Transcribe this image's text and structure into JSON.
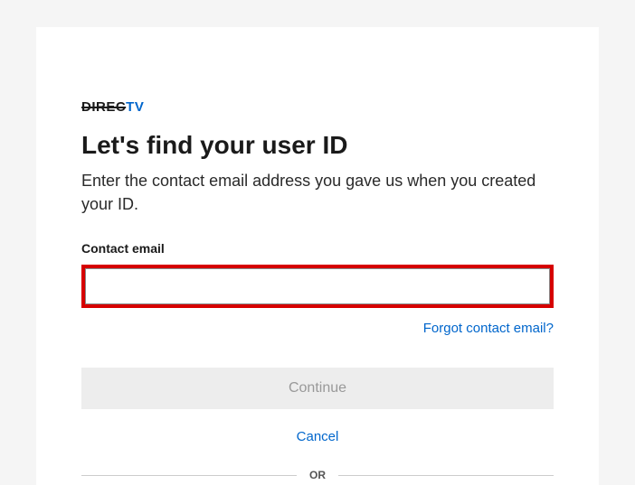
{
  "logo": {
    "part1": "DIREC",
    "part2": "TV"
  },
  "heading": "Let's find your user ID",
  "subheading": "Enter the contact email address you gave us when you created your ID.",
  "form": {
    "email_label": "Contact email",
    "email_value": "",
    "forgot_link": "Forgot contact email?",
    "continue_label": "Continue",
    "cancel_label": "Cancel"
  },
  "divider_text": "OR"
}
